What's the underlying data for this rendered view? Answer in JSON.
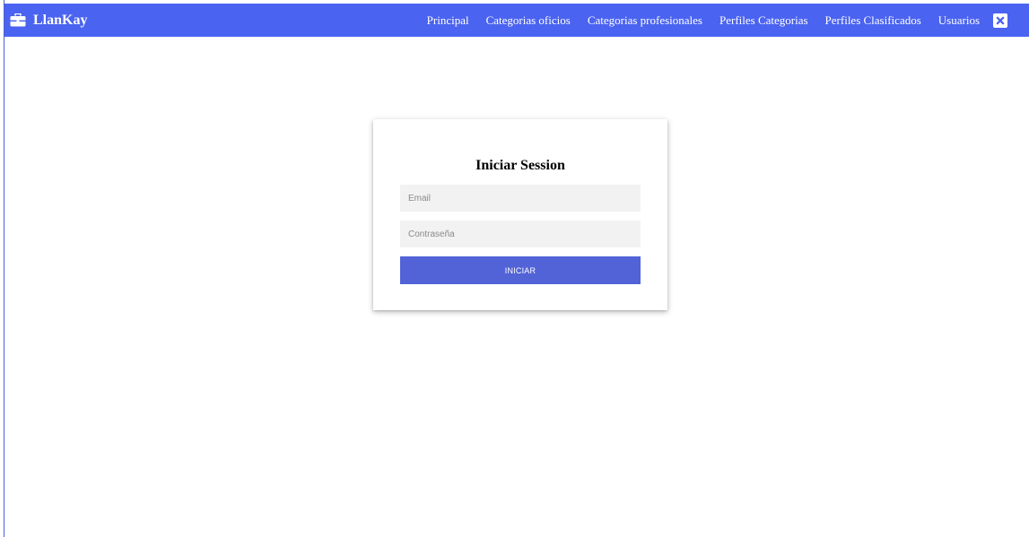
{
  "colors": {
    "navbar": "#4a63f0",
    "button": "#5163d6",
    "field_bg": "#f2f2f2"
  },
  "brand": {
    "icon": "briefcase-icon",
    "name": "LlanKay"
  },
  "nav": {
    "items": [
      {
        "label": "Principal"
      },
      {
        "label": "Categorias oficios"
      },
      {
        "label": "Categorias profesionales"
      },
      {
        "label": "Perfiles Categorias"
      },
      {
        "label": "Perfiles Clasificados"
      },
      {
        "label": "Usuarios"
      }
    ],
    "logout_icon": "close-box-icon"
  },
  "login": {
    "title": "Iniciar Session",
    "email_placeholder": "Email",
    "email_value": "",
    "password_placeholder": "Contraseña",
    "password_value": "",
    "submit_label": "INICIAR"
  }
}
